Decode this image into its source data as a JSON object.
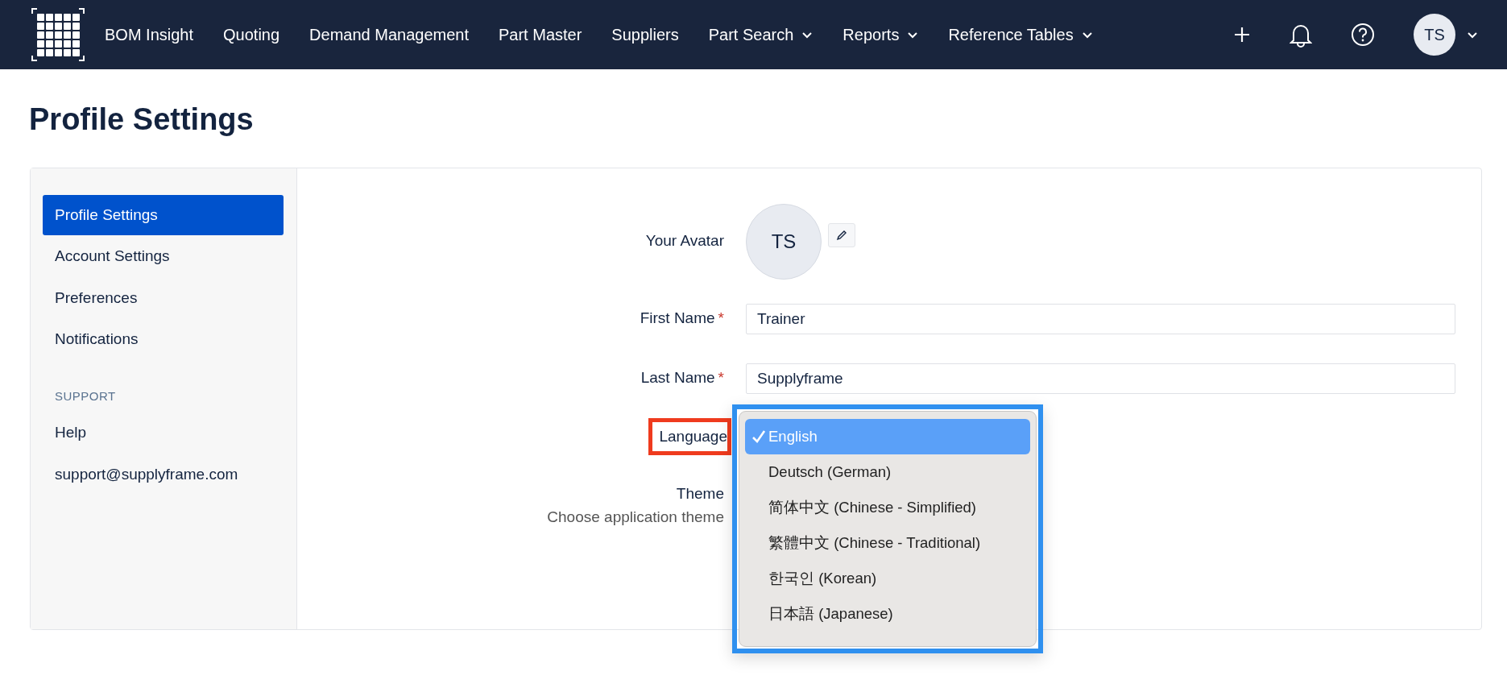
{
  "navbar": {
    "items": [
      {
        "label": "BOM Insight",
        "has_menu": false
      },
      {
        "label": "Quoting",
        "has_menu": false
      },
      {
        "label": "Demand Management",
        "has_menu": false
      },
      {
        "label": "Part Master",
        "has_menu": false
      },
      {
        "label": "Suppliers",
        "has_menu": false
      },
      {
        "label": "Part Search",
        "has_menu": true
      },
      {
        "label": "Reports",
        "has_menu": true
      },
      {
        "label": "Reference Tables",
        "has_menu": true
      }
    ],
    "user_initials": "TS"
  },
  "page_title": "Profile Settings",
  "sidebar": {
    "items": [
      {
        "label": "Profile Settings",
        "selected": true
      },
      {
        "label": "Account Settings",
        "selected": false
      },
      {
        "label": "Preferences",
        "selected": false
      },
      {
        "label": "Notifications",
        "selected": false
      }
    ],
    "support_heading": "SUPPORT",
    "support_items": [
      {
        "label": "Help"
      },
      {
        "label": "support@supplyframe.com"
      }
    ]
  },
  "form": {
    "avatar": {
      "label": "Your Avatar",
      "initials": "TS"
    },
    "fields": [
      {
        "label": "First Name",
        "required_mark": "*",
        "value": "Trainer"
      },
      {
        "label": "Last Name",
        "required_mark": "*",
        "value": "Supplyframe"
      }
    ],
    "language": {
      "label": "Language",
      "highlighted": true
    },
    "theme": {
      "label": "Theme",
      "hint": "Choose application theme"
    }
  },
  "language_menu": {
    "highlighted": true,
    "options": [
      {
        "label": "English",
        "selected": true
      },
      {
        "label": "Deutsch (German)",
        "selected": false
      },
      {
        "label": "简体中文 (Chinese - Simplified)",
        "selected": false
      },
      {
        "label": "繁體中文 (Chinese - Traditional)",
        "selected": false
      },
      {
        "label": "한국인 (Korean)",
        "selected": false
      },
      {
        "label": "日本語 (Japanese)",
        "selected": false
      }
    ]
  }
}
